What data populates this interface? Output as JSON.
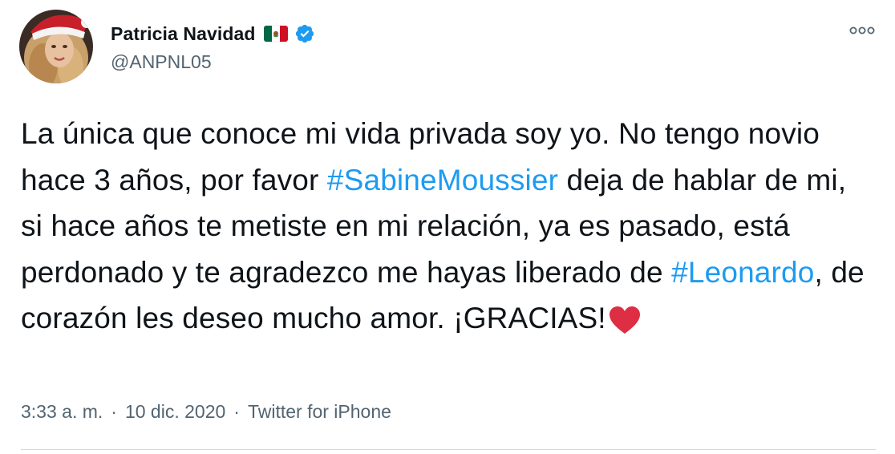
{
  "author": {
    "display_name": "Patricia Navidad",
    "handle": "@ANPNL05",
    "flag_icon": "mexico-flag-icon",
    "verified_icon": "verified-badge-icon"
  },
  "tweet": {
    "text_1": "La única que conoce mi vida privada soy yo. No tengo novio hace 3 años, por favor ",
    "hashtag_1": "#SabineMoussier",
    "text_2": " deja de hablar de mi, si hace años te metiste en mi relación, ya es pasado, está perdonado y te agradezco me hayas liberado de ",
    "hashtag_2": "#Leonardo",
    "text_3": ", de corazón les deseo mucho amor. ¡GRACIAS!",
    "emoji": "heart-emoji"
  },
  "meta": {
    "time": "3:33 a. m.",
    "separator": "·",
    "date": "10 dic. 2020",
    "source": "Twitter for iPhone"
  },
  "colors": {
    "link": "#1d9bf0",
    "text": "#0f1419",
    "secondary": "#536471",
    "verified": "#1d9bf0",
    "heart": "#dd2e44"
  }
}
